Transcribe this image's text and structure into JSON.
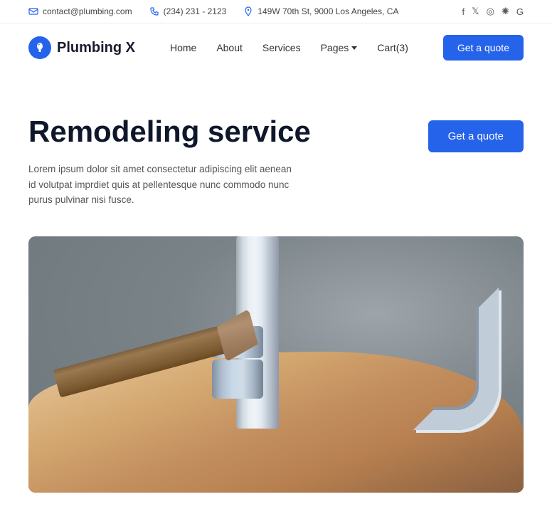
{
  "topbar": {
    "email": "contact@plumbing.com",
    "phone": "(234) 231 - 2123",
    "address": "149W 70th St, 9000 Los Angeles, CA"
  },
  "social": {
    "items": [
      "f",
      "t",
      "ig",
      "k",
      "G"
    ]
  },
  "header": {
    "logo_text": "Plumbing X",
    "nav": {
      "home": "Home",
      "about": "About",
      "services": "Services",
      "pages": "Pages",
      "cart": "Cart(3)"
    },
    "cta_button": "Get a quote"
  },
  "hero": {
    "title": "Remodeling service",
    "description": "Lorem ipsum dolor sit amet consectetur adipiscing elit aenean id volutpat imprdiet quis at pellentesque nunc commodo nunc purus pulvinar nisi fusce.",
    "cta_button": "Get a quote"
  },
  "colors": {
    "primary": "#2563eb",
    "text_dark": "#0f172a",
    "text_light": "#555555"
  }
}
